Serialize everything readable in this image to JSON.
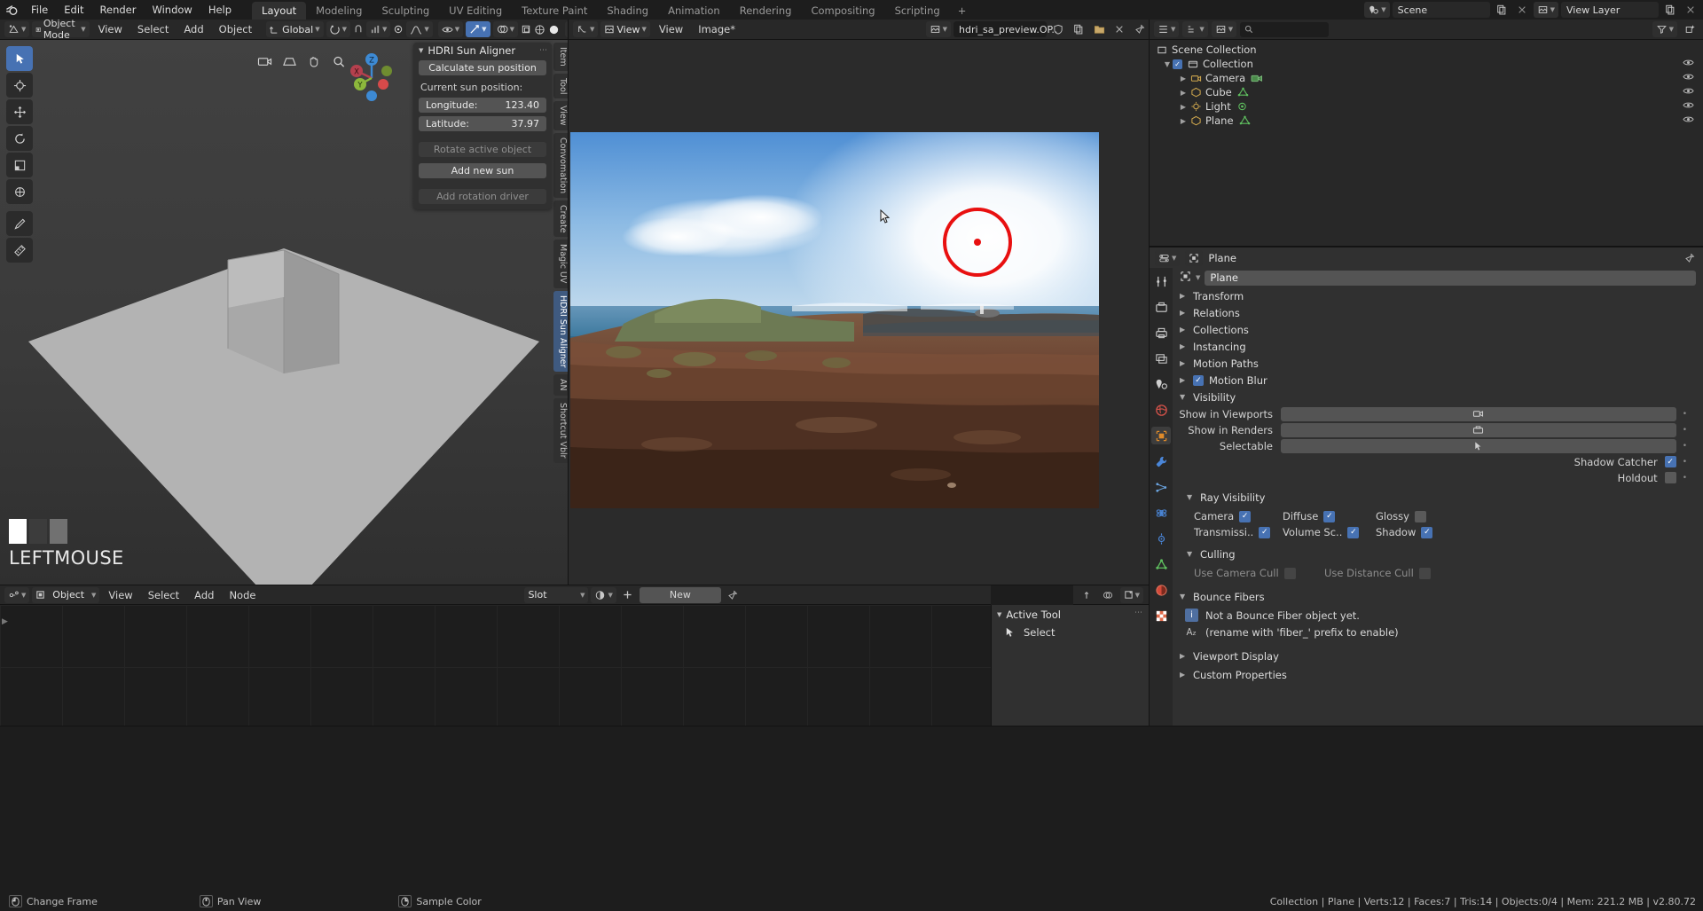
{
  "app": {
    "menus": [
      "File",
      "Edit",
      "Render",
      "Window",
      "Help"
    ],
    "workspaces": [
      {
        "label": "Layout",
        "active": true
      },
      {
        "label": "Modeling",
        "active": false
      },
      {
        "label": "Sculpting",
        "active": false
      },
      {
        "label": "UV Editing",
        "active": false
      },
      {
        "label": "Texture Paint",
        "active": false
      },
      {
        "label": "Shading",
        "active": false
      },
      {
        "label": "Animation",
        "active": false
      },
      {
        "label": "Rendering",
        "active": false
      },
      {
        "label": "Compositing",
        "active": false
      },
      {
        "label": "Scripting",
        "active": false
      },
      {
        "label": "+",
        "active": false
      }
    ],
    "scene_field": "Scene",
    "viewlayer_field": "View Layer"
  },
  "viewport_header": {
    "mode": "Object Mode",
    "menus": [
      "View",
      "Select",
      "Add",
      "Object"
    ],
    "transform_orientation": "Global"
  },
  "viewport": {
    "status_text": "LEFTMOUSE",
    "gizmo_axes": [
      "X",
      "Y",
      "Z"
    ]
  },
  "npanel": {
    "title": "HDRI Sun Aligner",
    "calculate_button": "Calculate sun position",
    "section_label": "Current sun position:",
    "rows": [
      {
        "label": "Longitude:",
        "value": "123.40"
      },
      {
        "label": "Latitude:",
        "value": "37.97"
      }
    ],
    "rotate_button": "Rotate active object",
    "add_sun_button": "Add new sun",
    "add_driver_button": "Add rotation driver",
    "tabs": [
      "Item",
      "Tool",
      "View",
      "Convomation",
      "Create",
      "Magic UV",
      "HDRI Sun Aligner",
      "AN",
      "Shortcut Vblr"
    ]
  },
  "image_editor": {
    "menus": [
      "View",
      "Image*"
    ],
    "view_label": "View",
    "image_name": "hdri_sa_preview.OP.."
  },
  "shader_editor": {
    "mode": "Object",
    "menus": [
      "View",
      "Select",
      "Add",
      "Node"
    ],
    "slot_label": "Slot",
    "new_button": "New"
  },
  "shader_npanel": {
    "title": "Active Tool",
    "tool_name": "Select"
  },
  "outliner": {
    "root": "Scene Collection",
    "items": [
      {
        "label": "Collection",
        "depth": 1,
        "icon": "collection-icon",
        "checkbox": true,
        "triangle": true
      },
      {
        "label": "Camera",
        "depth": 2,
        "icon": "camera-icon",
        "triangle": true
      },
      {
        "label": "Cube",
        "depth": 2,
        "icon": "mesh-icon",
        "triangle": true
      },
      {
        "label": "Light",
        "depth": 2,
        "icon": "light-icon",
        "triangle": true
      },
      {
        "label": "Plane",
        "depth": 2,
        "icon": "mesh-icon",
        "triangle": true
      }
    ],
    "search_placeholder": ""
  },
  "properties": {
    "breadcrumb_object": "Plane",
    "object_name": "Plane",
    "sections": [
      {
        "label": "Transform",
        "open": false
      },
      {
        "label": "Relations",
        "open": false
      },
      {
        "label": "Collections",
        "open": false
      },
      {
        "label": "Instancing",
        "open": false
      },
      {
        "label": "Motion Paths",
        "open": false
      },
      {
        "label": "Motion Blur",
        "open": false,
        "checkbox": true
      },
      {
        "label": "Visibility",
        "open": true
      }
    ],
    "visibility": {
      "rows": [
        {
          "label": "Show in Viewports",
          "type": "icon",
          "icon": "camera-icon"
        },
        {
          "label": "Show in Renders",
          "type": "icon",
          "icon": "render-icon"
        },
        {
          "label": "Selectable",
          "type": "icon",
          "icon": "cursor-icon"
        }
      ],
      "checks": [
        {
          "label": "Shadow Catcher",
          "checked": true
        },
        {
          "label": "Holdout",
          "checked": false
        }
      ]
    },
    "ray_visibility": {
      "label": "Ray Visibility",
      "items": [
        {
          "label": "Camera",
          "checked": true
        },
        {
          "label": "Diffuse",
          "checked": true
        },
        {
          "label": "Glossy",
          "checked": false
        },
        {
          "label": "Transmissi..",
          "checked": true
        },
        {
          "label": "Volume Sc..",
          "checked": true
        },
        {
          "label": "Shadow",
          "checked": true
        }
      ]
    },
    "culling": {
      "label": "Culling",
      "items": [
        {
          "label": "Use Camera Cull",
          "checked": false
        },
        {
          "label": "Use Distance Cull",
          "checked": false
        }
      ]
    },
    "bounce_fibers": {
      "label": "Bounce Fibers",
      "info": "Not a Bounce Fiber object yet.",
      "hint": "(rename with 'fiber_' prefix to enable)"
    },
    "trailing_sections": [
      {
        "label": "Viewport Display",
        "open": false
      },
      {
        "label": "Custom Properties",
        "open": false
      }
    ]
  },
  "statusbar": {
    "hints": [
      {
        "icon": "mouse-left-icon",
        "label": "Change Frame"
      },
      {
        "icon": "mouse-middle-icon",
        "label": "Pan View"
      },
      {
        "icon": "mouse-right-icon",
        "label": "Sample Color"
      }
    ],
    "stats": "Collection | Plane | Verts:12 | Faces:7 | Tris:14 | Objects:0/4 | Mem: 221.2 MB | v2.80.72"
  },
  "colors": {
    "accent_blue": "#4772b3",
    "marker_red": "#e81010",
    "panel_bg": "#303030",
    "header_bg": "#282828",
    "editor_bg": "#1d1d1d"
  }
}
